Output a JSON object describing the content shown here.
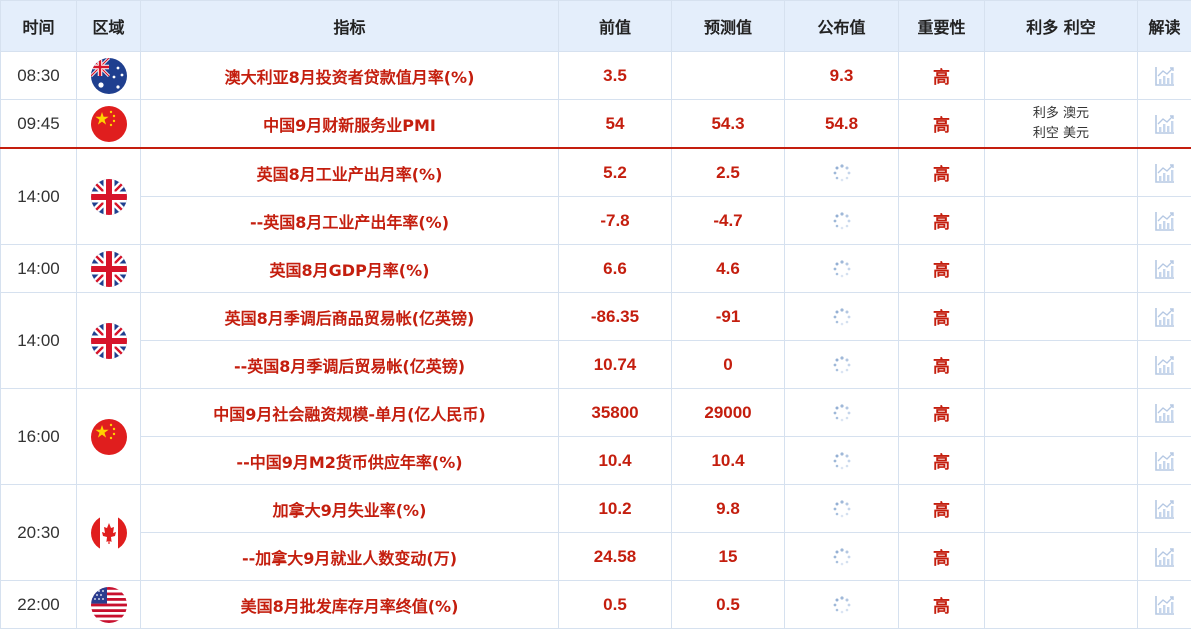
{
  "headers": {
    "time": "时间",
    "region": "区域",
    "indicator": "指标",
    "previous": "前值",
    "forecast": "预测值",
    "actual": "公布值",
    "importance": "重要性",
    "impact": "利多 利空",
    "analysis": "解读"
  },
  "rows": [
    {
      "time": "08:30",
      "region_icon": "australia-flag-icon",
      "indicator": "澳大利亚8月投资者贷款值月率(%)",
      "previous": "3.5",
      "forecast": "",
      "actual": "9.3",
      "importance": "高",
      "impact": []
    },
    {
      "time": "09:45",
      "region_icon": "china-flag-icon",
      "indicator": "中国9月财新服务业PMI",
      "previous": "54",
      "forecast": "54.3",
      "actual": "54.8",
      "importance": "高",
      "impact": [
        "利多   澳元",
        "利空   美元"
      ]
    },
    {
      "time": "14:00",
      "region_icon": "uk-flag-icon",
      "indicator": "英国8月工业产出月率(%)",
      "previous": "5.2",
      "forecast": "2.5",
      "actual": "",
      "importance": "高",
      "impact": []
    },
    {
      "time": "",
      "region_icon": "",
      "indicator": "--英国8月工业产出年率(%)",
      "previous": "-7.8",
      "forecast": "-4.7",
      "actual": "",
      "importance": "高",
      "impact": []
    },
    {
      "time": "14:00",
      "region_icon": "uk-flag-icon",
      "indicator": "英国8月GDP月率(%)",
      "previous": "6.6",
      "forecast": "4.6",
      "actual": "",
      "importance": "高",
      "impact": []
    },
    {
      "time": "14:00",
      "region_icon": "uk-flag-icon",
      "indicator": "英国8月季调后商品贸易帐(亿英镑)",
      "previous": "-86.35",
      "forecast": "-91",
      "actual": "",
      "importance": "高",
      "impact": []
    },
    {
      "time": "",
      "region_icon": "",
      "indicator": "--英国8月季调后贸易帐(亿英镑)",
      "previous": "10.74",
      "forecast": "0",
      "actual": "",
      "importance": "高",
      "impact": []
    },
    {
      "time": "16:00",
      "region_icon": "china-flag-icon",
      "indicator": "中国9月社会融资规模-单月(亿人民币)",
      "previous": "35800",
      "forecast": "29000",
      "actual": "",
      "importance": "高",
      "impact": []
    },
    {
      "time": "",
      "region_icon": "",
      "indicator": "--中国9月M2货币供应年率(%)",
      "previous": "10.4",
      "forecast": "10.4",
      "actual": "",
      "importance": "高",
      "impact": []
    },
    {
      "time": "20:30",
      "region_icon": "canada-flag-icon",
      "indicator": "加拿大9月失业率(%)",
      "previous": "10.2",
      "forecast": "9.8",
      "actual": "",
      "importance": "高",
      "impact": []
    },
    {
      "time": "",
      "region_icon": "",
      "indicator": "--加拿大9月就业人数变动(万)",
      "previous": "24.58",
      "forecast": "15",
      "actual": "",
      "importance": "高",
      "impact": []
    },
    {
      "time": "22:00",
      "region_icon": "us-flag-icon",
      "indicator": "美国8月批发库存月率终值(%)",
      "previous": "0.5",
      "forecast": "0.5",
      "actual": "",
      "importance": "高",
      "impact": []
    }
  ],
  "colors": {
    "header_bg": "#e4eefb",
    "accent_red": "#c41e0e",
    "border": "#d6e1ef"
  }
}
